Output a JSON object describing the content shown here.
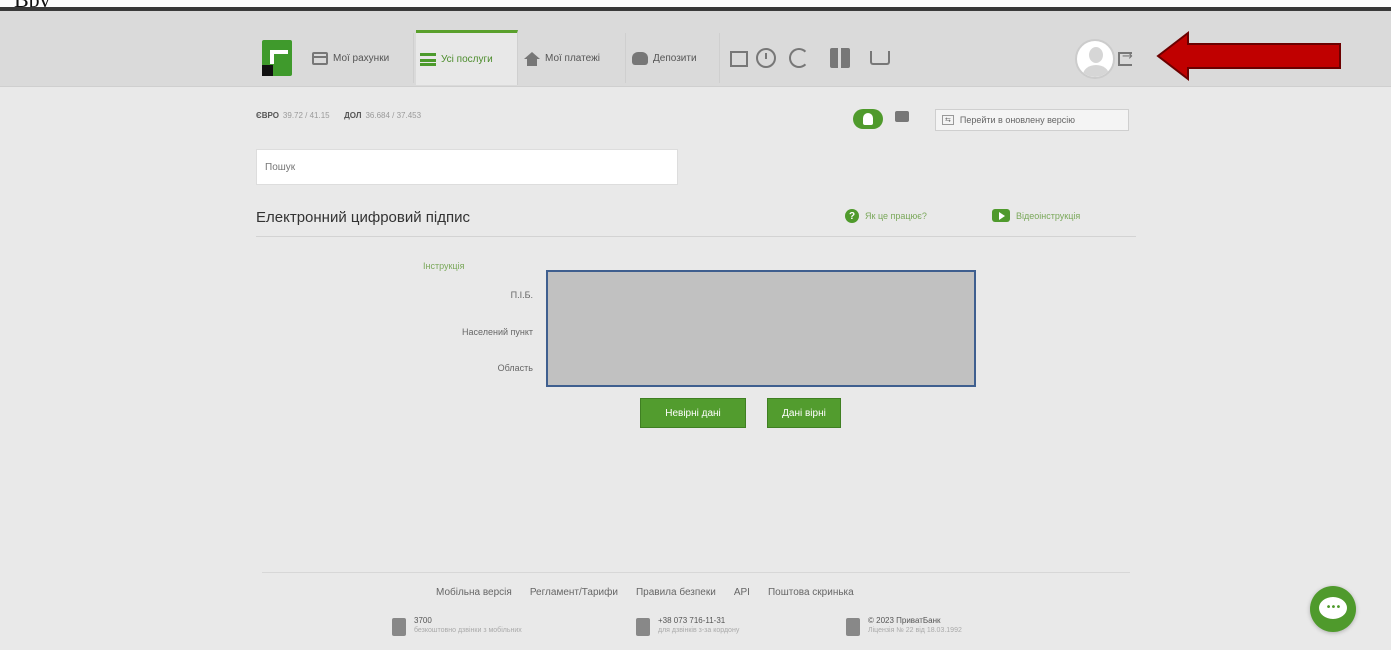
{
  "doc_caption": "Вру",
  "nav": {
    "tabs": [
      {
        "label": "Мої рахунки",
        "icon": "card-icon"
      },
      {
        "label": "Усі послуги",
        "icon": "list-icon"
      },
      {
        "label": "Мої платежі",
        "icon": "house-icon"
      },
      {
        "label": "Депозити",
        "icon": "moneybag-icon"
      }
    ],
    "active_tab": "Усі послуги"
  },
  "rates": {
    "eur_label": "ЄВРО",
    "eur_value": "39.72 / 41.15",
    "usd_label": "ДОЛ",
    "usd_value": "36.684 / 37.453"
  },
  "switch_version_label": "Перейти в оновлену версію",
  "search": {
    "placeholder": "Пошук"
  },
  "section": {
    "title": "Електронний цифровий підпис",
    "help_link": "Як це працює?",
    "video_link": "Відеоінструкція"
  },
  "form": {
    "instruction_link": "Інструкція",
    "fields": [
      {
        "label": "П.І.Б."
      },
      {
        "label": "Населений пункт"
      },
      {
        "label": "Область"
      }
    ],
    "buttons": {
      "wrong": "Невірні дані",
      "correct": "Дані вірні"
    }
  },
  "footer": {
    "links": [
      "Мобільна версія",
      "Регламент/Тарифи",
      "Правила безпеки",
      "API",
      "Поштова скринька"
    ],
    "items": [
      {
        "title": "3700",
        "subtitle": "безкоштовно дзвінки з мобільних"
      },
      {
        "title": "+38 073 716-11-31",
        "subtitle": "для дзвінків з-за кордону"
      },
      {
        "title": "© 2023 ПриватБанк",
        "subtitle": "Ліцензія № 22 від 18.03.1992"
      }
    ]
  },
  "colors": {
    "accent_green": "#529c2e",
    "arrow_red": "#c00000",
    "redaction_border": "#3f5f8f"
  }
}
